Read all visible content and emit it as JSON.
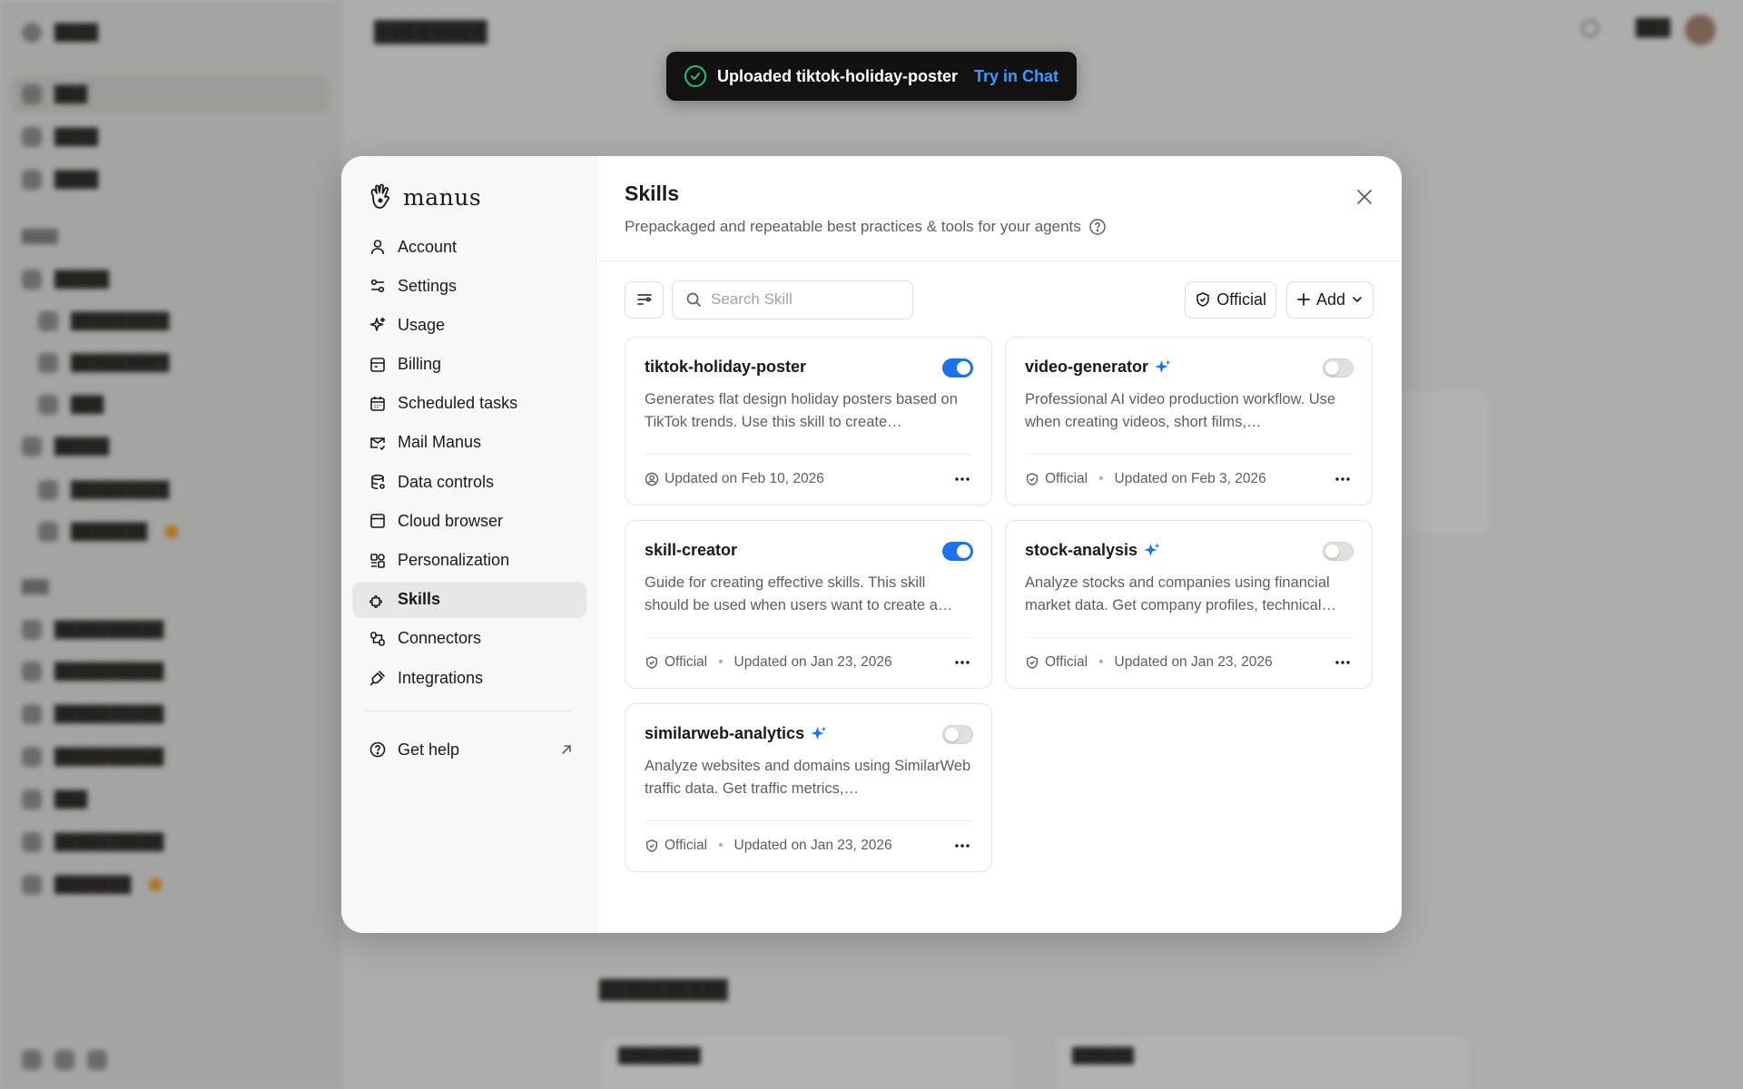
{
  "toast": {
    "message": "Uploaded tiktok-holiday-poster",
    "action": "Try in Chat"
  },
  "brand": {
    "name": "manus"
  },
  "nav": {
    "items": [
      {
        "label": "Account",
        "icon": "user-icon"
      },
      {
        "label": "Settings",
        "icon": "settings-sliders-icon"
      },
      {
        "label": "Usage",
        "icon": "sparkle-icon"
      },
      {
        "label": "Billing",
        "icon": "billing-icon"
      },
      {
        "label": "Scheduled tasks",
        "icon": "calendar-icon"
      },
      {
        "label": "Mail Manus",
        "icon": "mail-icon"
      },
      {
        "label": "Data controls",
        "icon": "database-icon"
      },
      {
        "label": "Cloud browser",
        "icon": "browser-window-icon"
      },
      {
        "label": "Personalization",
        "icon": "personalization-icon"
      },
      {
        "label": "Skills",
        "icon": "puzzle-icon",
        "active": true
      },
      {
        "label": "Connectors",
        "icon": "connectors-icon"
      },
      {
        "label": "Integrations",
        "icon": "plug-icon"
      }
    ],
    "help": "Get help"
  },
  "skills": {
    "title": "Skills",
    "subtitle": "Prepackaged and repeatable best practices & tools for your agents",
    "search_placeholder": "Search Skill",
    "official_label": "Official",
    "add_label": "Add",
    "cards": [
      {
        "name": "tiktok-holiday-poster",
        "sparkle": false,
        "enabled": true,
        "description": "Generates flat design holiday posters based on TikTok trends. Use this skill to create…",
        "official": false,
        "updated": "Updated on Feb 10, 2026"
      },
      {
        "name": "video-generator",
        "sparkle": true,
        "enabled": false,
        "description": "Professional AI video production workflow. Use when creating videos, short films,…",
        "official": true,
        "official_label": "Official",
        "updated": "Updated on Feb 3, 2026"
      },
      {
        "name": "skill-creator",
        "sparkle": false,
        "enabled": true,
        "description": "Guide for creating effective skills. This skill should be used when users want to create a…",
        "official": true,
        "official_label": "Official",
        "updated": "Updated on Jan 23, 2026"
      },
      {
        "name": "stock-analysis",
        "sparkle": true,
        "enabled": false,
        "description": "Analyze stocks and companies using financial market data. Get company profiles, technical…",
        "official": true,
        "official_label": "Official",
        "updated": "Updated on Jan 23, 2026"
      },
      {
        "name": "similarweb-analytics",
        "sparkle": true,
        "enabled": false,
        "description": "Analyze websites and domains using SimilarWeb traffic data. Get traffic metrics,…",
        "official": true,
        "official_label": "Official",
        "updated": "Updated on Jan 23, 2026"
      }
    ]
  },
  "colors": {
    "accent": "#1a73e8",
    "success": "#25c06f",
    "link": "#3b9bff"
  }
}
